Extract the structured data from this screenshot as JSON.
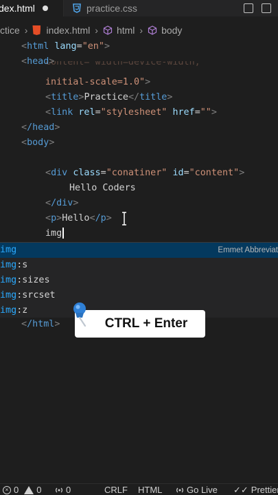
{
  "tabs": [
    {
      "label": "dex.html",
      "active": true,
      "modified": true
    },
    {
      "label": "practice.css",
      "active": false
    }
  ],
  "breadcrumb": [
    "ctice",
    "index.html",
    "html",
    "body"
  ],
  "code_lines": {
    "l1_tag": "html",
    "l1_attr": "lang",
    "l1_val": "\"en\"",
    "l2_tag": "head",
    "l3_text": "content=\"width=device-width,",
    "l4_text": "initial-scale=1.0\"",
    "l5_tag": "title",
    "l5_text": "Practice",
    "l6_tag": "link",
    "l6_attr1": "rel",
    "l6_val1": "\"stylesheet\"",
    "l6_attr2": "href",
    "l6_val2": "\"\"",
    "l7_tag": "/head",
    "l8_tag": "body",
    "l10_tag": "div",
    "l10_attr1": "class",
    "l10_val1": "\"conatiner\"",
    "l10_attr2": "id",
    "l10_val2": "\"content\"",
    "l11_text": "Hello Coders",
    "l12_tag": "/div",
    "l13_tag": "p",
    "l13_text": "Hello",
    "l13_close": "/p",
    "l14_text": "img",
    "l15_tag": "/html"
  },
  "suggestions": {
    "items": [
      {
        "highlight": "img",
        "rest": ""
      },
      {
        "highlight": "img",
        "rest": ":s"
      },
      {
        "highlight": "img",
        "rest": ":sizes"
      },
      {
        "highlight": "img",
        "rest": ":srcset"
      },
      {
        "highlight": "img",
        "rest": ":z"
      }
    ],
    "detail": "Emmet Abbreviat"
  },
  "hint": {
    "text": "CTRL + Enter"
  },
  "statusbar": {
    "errors": "0",
    "warnings": "0",
    "ports": "0",
    "eol": "CRLF",
    "language": "HTML",
    "golive": "Go Live",
    "prettier": "Prettier"
  },
  "colors": {
    "background": "#1e1e1e",
    "tag": "#569cd6",
    "attribute": "#9cdcfe",
    "string": "#ce9178",
    "selection": "#04395e"
  }
}
